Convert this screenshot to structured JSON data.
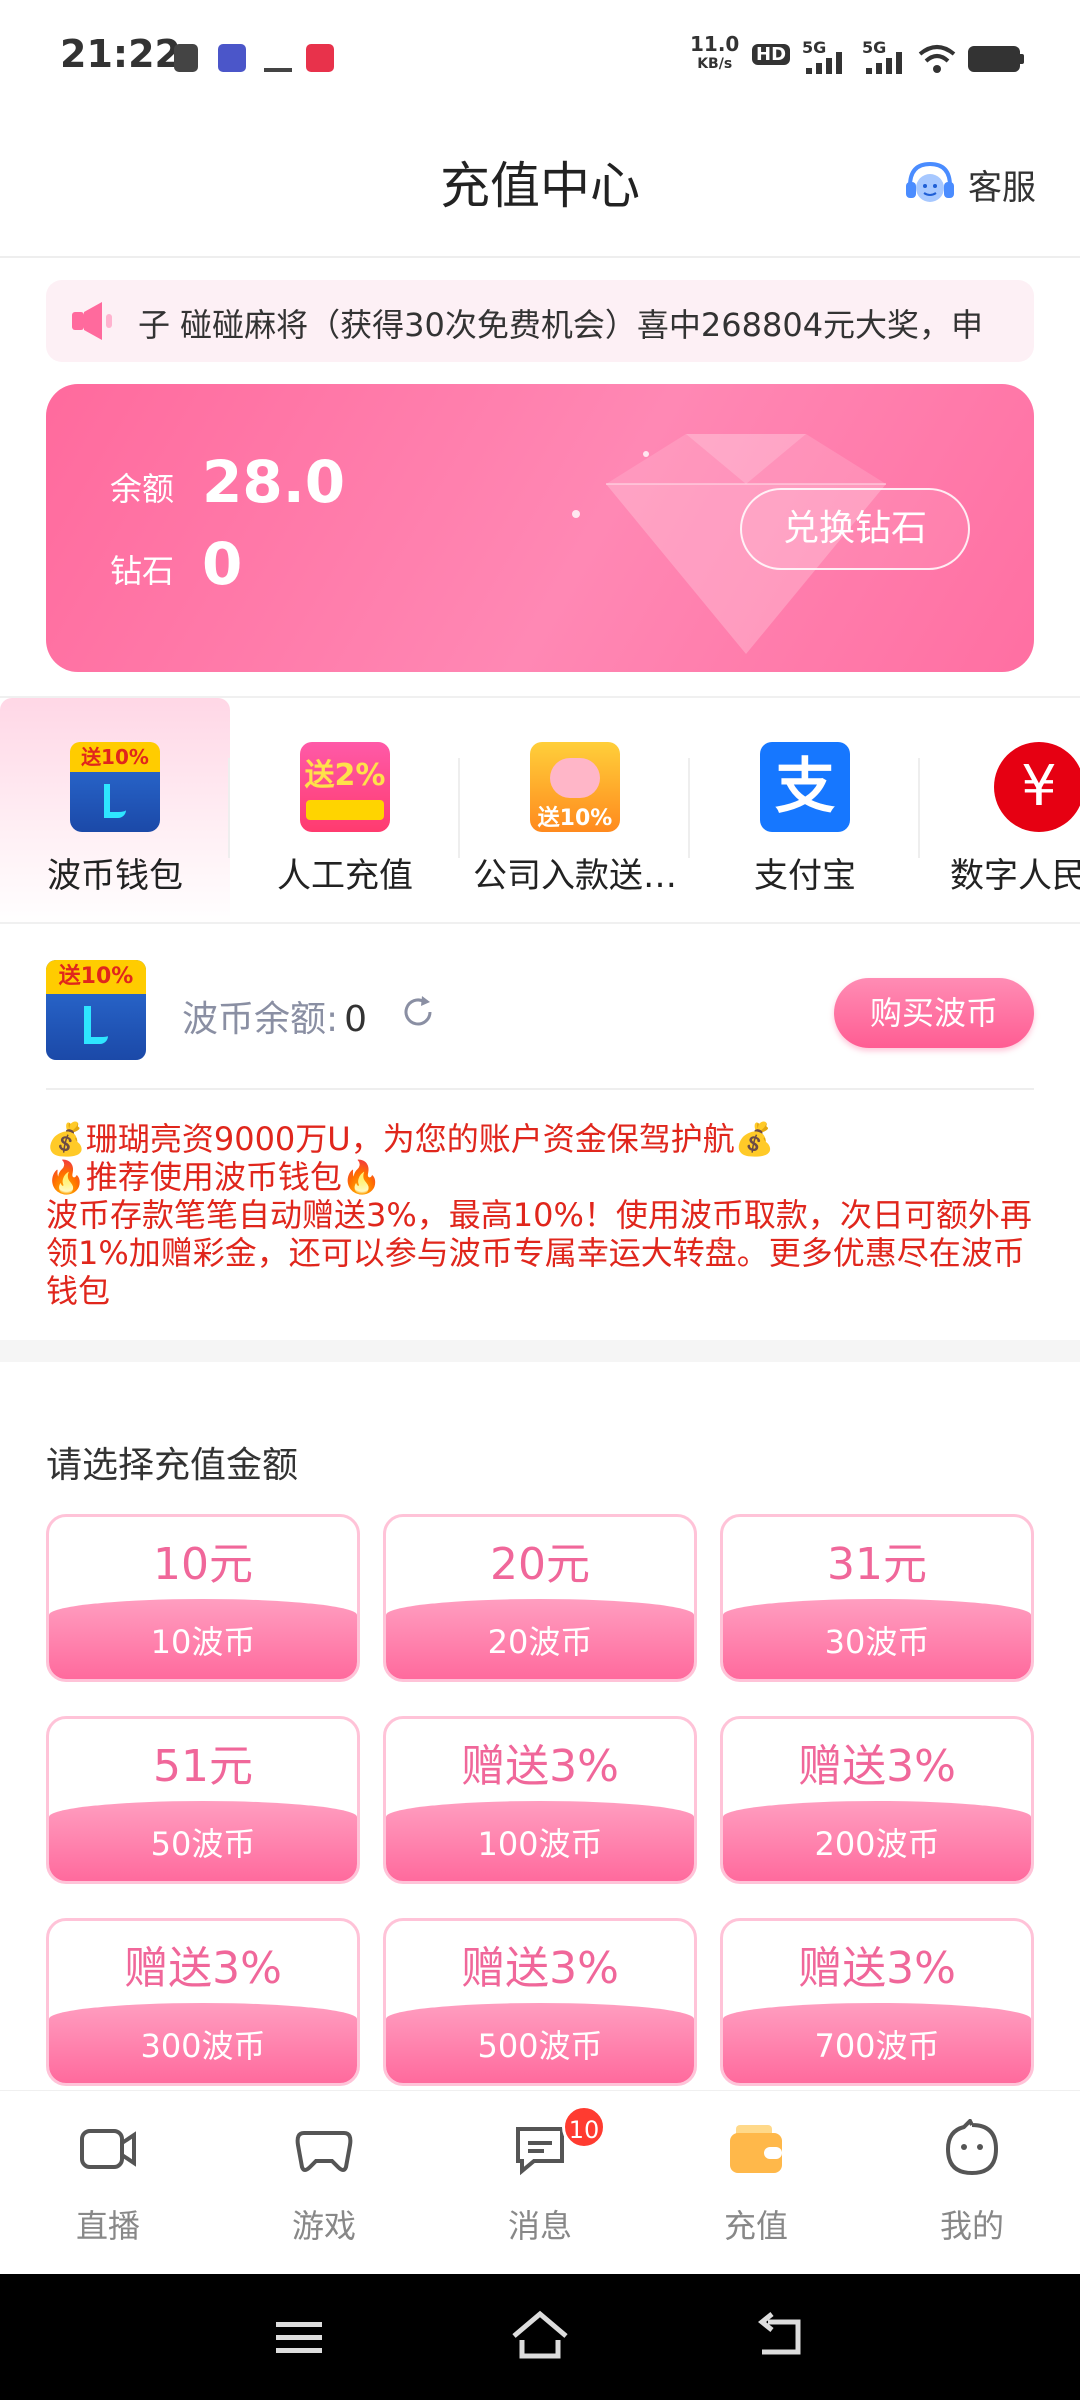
{
  "status_bar": {
    "time": "21:22",
    "net_speed_top": "11.0",
    "net_speed_bottom": "KB/s",
    "hd": "HD",
    "signal1": "5G",
    "signal2": "5G"
  },
  "header": {
    "title": "充值中心",
    "service_label": "客服"
  },
  "notice": {
    "text": "子 碰碰麻将（获得30次免费机会）喜中268804元大奖，申"
  },
  "balance": {
    "balance_label": "余额",
    "balance_value": "28.0",
    "diamond_label": "钻石",
    "diamond_value": "0",
    "exchange_label": "兑换钻石"
  },
  "payment_methods": [
    {
      "label": "波币钱包",
      "icon": "bobi-wallet-icon",
      "badge": "送10%"
    },
    {
      "label": "人工充值",
      "icon": "manual-recharge-icon",
      "badge": "送2%"
    },
    {
      "label": "公司入款送…",
      "icon": "piggy-bank-icon",
      "badge": "送10%"
    },
    {
      "label": "支付宝",
      "icon": "alipay-icon",
      "badge": ""
    },
    {
      "label": "数字人民",
      "icon": "digital-rmb-icon",
      "badge": ""
    }
  ],
  "wallet": {
    "badge": "送10%",
    "balance_label": "波币余额:",
    "balance_value": "0",
    "buy_label": "购买波币"
  },
  "promo": {
    "line1": "💰珊瑚亮资9000万U，为您的账户资金保驾护航💰",
    "line2": "🔥推荐使用波币钱包🔥",
    "line3": "波币存款笔笔自动赠送3%，最高10%！使用波币取款，次日可额外再领1%加赠彩金，还可以参与波币专属幸运大转盘。更多优惠尽在波币钱包"
  },
  "amounts": {
    "title": "请选择充值金额",
    "items": [
      {
        "top": "10元",
        "bottom": "10波币"
      },
      {
        "top": "20元",
        "bottom": "20波币"
      },
      {
        "top": "31元",
        "bottom": "30波币"
      },
      {
        "top": "51元",
        "bottom": "50波币"
      },
      {
        "top": "赠送3%",
        "bottom": "100波币"
      },
      {
        "top": "赠送3%",
        "bottom": "200波币"
      },
      {
        "top": "赠送3%",
        "bottom": "300波币"
      },
      {
        "top": "赠送3%",
        "bottom": "500波币"
      },
      {
        "top": "赠送3%",
        "bottom": "700波币"
      }
    ]
  },
  "bottom_nav": {
    "items": [
      {
        "label": "直播",
        "icon": "video-camera-icon"
      },
      {
        "label": "游戏",
        "icon": "gamepad-icon"
      },
      {
        "label": "消息",
        "icon": "message-icon"
      },
      {
        "label": "充值",
        "icon": "wallet-icon"
      },
      {
        "label": "我的",
        "icon": "profile-face-icon"
      }
    ],
    "message_badge": "10",
    "active": "充值"
  },
  "colors": {
    "accent_pink": "#ff6a9d",
    "promo_red": "#e0261c",
    "amount_text": "#f0679a"
  }
}
